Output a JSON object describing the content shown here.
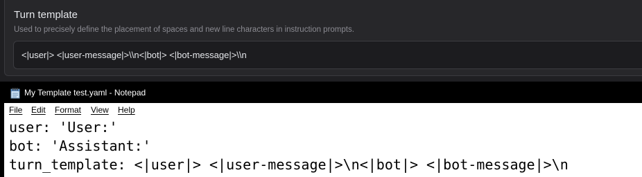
{
  "settings_panel": {
    "title": "Turn template",
    "description": "Used to precisely define the placement of spaces and new line characters in instruction prompts.",
    "input_value": "<|user|> <|user-message|>\\\\n<|bot|> <|bot-message|>\\\\n"
  },
  "notepad": {
    "window_title": "My Template test.yaml - Notepad",
    "app_icon": "notepad-icon",
    "menu": [
      "File",
      "Edit",
      "Format",
      "View",
      "Help"
    ],
    "lines": [
      "user: 'User:'",
      "bot: 'Assistant:'",
      "turn_template: <|user|> <|user-message|>\\n<|bot|> <|bot-message|>\\n"
    ]
  },
  "colors": {
    "panel_background": "#27272a",
    "input_background": "#1c1c1f",
    "titlebar_background": "#000000",
    "editor_background": "#ffffff"
  }
}
